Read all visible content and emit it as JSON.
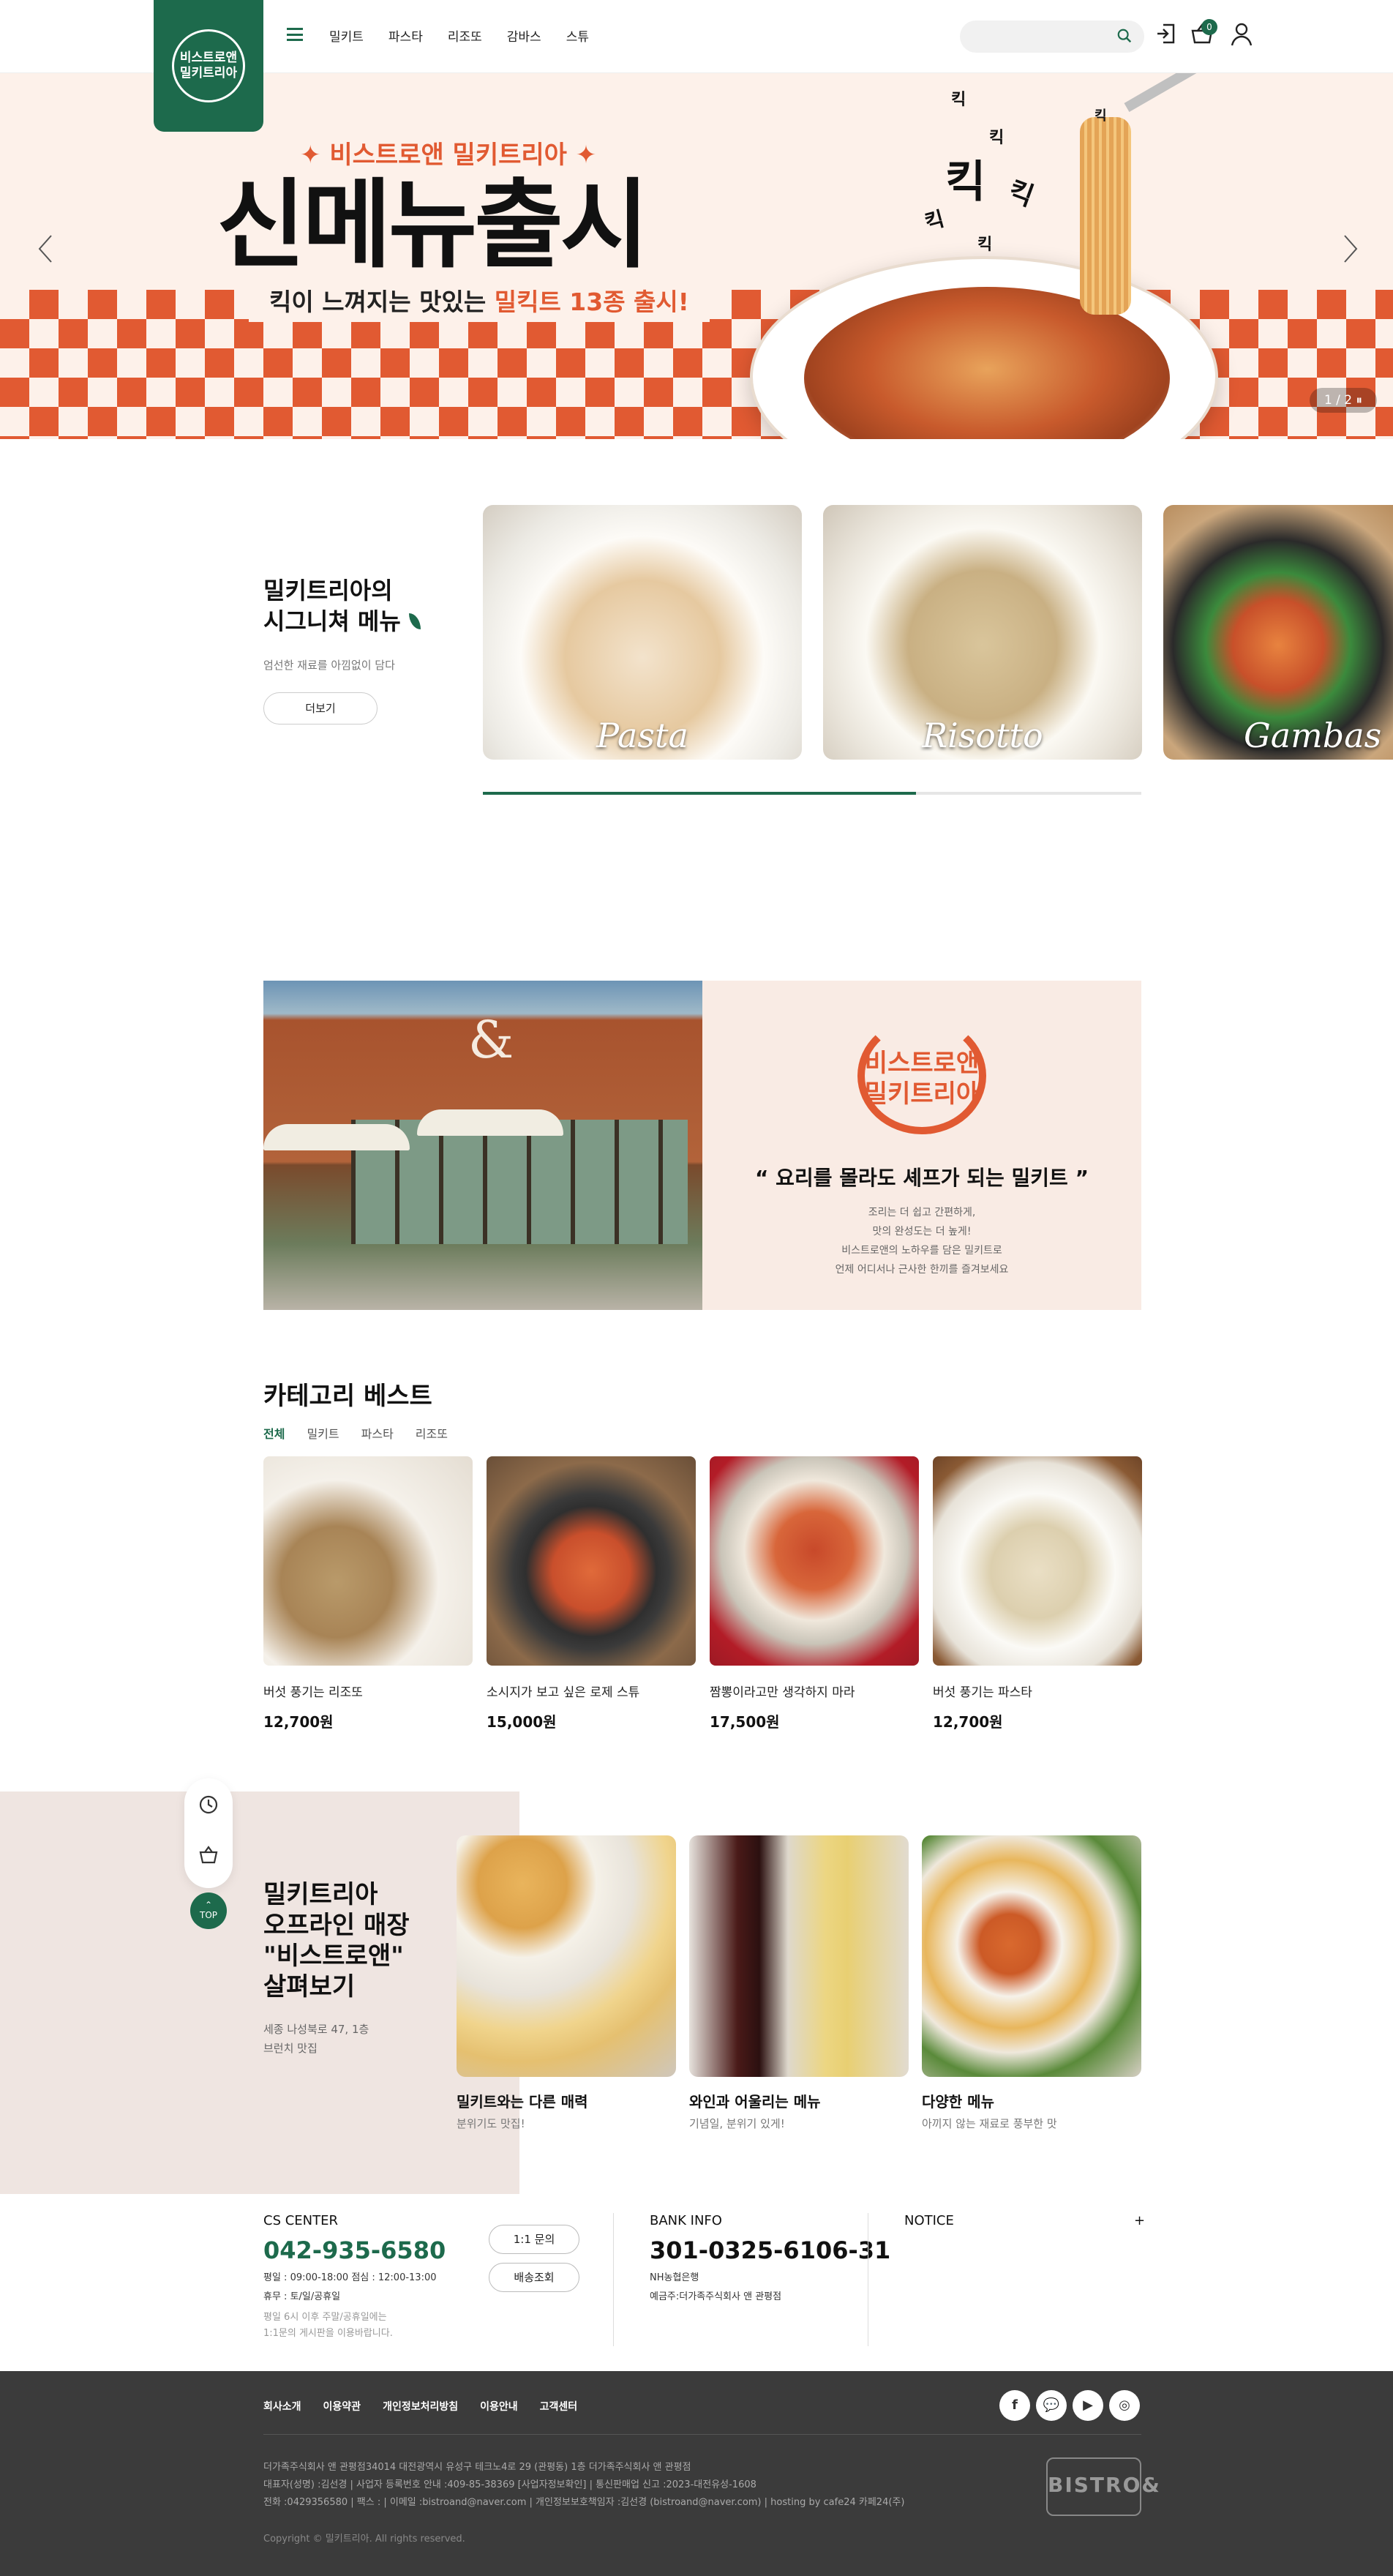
{
  "header": {
    "logo_line1": "비스트로앤",
    "logo_line2": "밀키트리아",
    "nav": [
      "밀키트",
      "파스타",
      "리조또",
      "감바스",
      "스튜"
    ],
    "search_placeholder": "",
    "cart_count": "0"
  },
  "banner": {
    "subtitle": "✦ 비스트로앤 밀키트리아 ✦",
    "title": "신메뉴출시",
    "copy_prefix": "킥이 느껴지는 맛있는 ",
    "copy_highlight": "밀킥트 13종 출시!",
    "sfx": [
      "킥",
      "킥",
      "킥",
      "킥",
      "킥",
      "킥",
      "킥"
    ],
    "pager": "1 / 2  ⏸"
  },
  "signature": {
    "title_line1": "밀키트리아의",
    "title_line2": "시그니쳐 메뉴",
    "desc": "엄선한 재료를 아낌없이 담다",
    "more": "더보기",
    "cards": [
      "Pasta",
      "Risotto",
      "Gambas"
    ]
  },
  "brand": {
    "logo_line1": "비스트로앤",
    "logo_line2": "밀키트리아",
    "quote": "“  요리를 몰라도 셰프가 되는 밀키트  ”",
    "lines": [
      "조리는 더 쉽고 간편하게,",
      "맛의 완성도는 더 높게!",
      "비스트로앤의 노하우를 담은 밀키트로",
      "언제 어디서나 근사한 한끼를 즐겨보세요"
    ]
  },
  "category": {
    "title": "카테고리 베스트",
    "tabs": [
      "전체",
      "밀키트",
      "파스타",
      "리조또"
    ],
    "products": [
      {
        "name": "버섯 풍기는 리조또",
        "price": "12,700원"
      },
      {
        "name": "소시지가 보고 싶은 로제 스튜",
        "price": "15,000원"
      },
      {
        "name": "짬뽕이라고만 생각하지 마라",
        "price": "17,500원"
      },
      {
        "name": "버섯 풍기는 파스타",
        "price": "12,700원"
      }
    ]
  },
  "offline": {
    "title_lines": [
      "밀키트리아",
      "오프라인 매장",
      "\"비스트로앤\"",
      "살펴보기"
    ],
    "desc_lines": [
      "세종 나성북로 47, 1층",
      "브런치 맛집"
    ],
    "top": "TOP",
    "cards": [
      {
        "title": "밀키트와는 다른 매력",
        "sub": "분위기도 맛집!"
      },
      {
        "title": "와인과 어울리는 메뉴",
        "sub": "기념일, 분위기 있게!"
      },
      {
        "title": "다양한 메뉴",
        "sub": "아끼지 않는 재료로 풍부한 맛"
      }
    ]
  },
  "cs": {
    "label": "CS CENTER",
    "phone": "042-935-6580",
    "lines": [
      "평일 : 09:00-18:00 점심 : 12:00-13:00",
      "휴무 : 토/일/공휴일"
    ],
    "notes": [
      "평일 6시 이후 주말/공휴일에는",
      "1:1문의 게시판을 이용바랍니다."
    ],
    "btn_inquiry": "1:1 문의",
    "btn_delivery": "배송조회",
    "bank_label": "BANK INFO",
    "bank_no": "301-0325-6106-31",
    "bank_lines": [
      "NH농협은행",
      "예금주:더가족주식회사 앤 관평점"
    ],
    "notice_label": "NOTICE",
    "notice_plus": "+"
  },
  "footer": {
    "links": [
      "회사소개",
      "이용약관",
      "개인정보처리방침",
      "이용안내",
      "고객센터"
    ],
    "sns": [
      "f",
      "💬",
      "▶",
      "◎"
    ],
    "info": [
      "더가족주식회사 앤 관평점34014 대전광역시 유성구 테크노4로 29 (관평동) 1층 더가족주식회사 앤 관평점",
      "대표자(성명) :김선경  |  사업자 등록번호 안내 :409-85-38369 [사업자정보확인]  |  통신판매업 신고 :2023-대전유성-1608",
      "전화 :0429356580  |  팩스 :  |  이메일 :bistroand@naver.com  |  개인정보보호책임자 :김선경 (bistroand@naver.com)  |  hosting by cafe24 카페24(주)"
    ],
    "copyright": "Copyright © 밀키트리아. All rights reserved.",
    "mark": "BISTRO&"
  }
}
